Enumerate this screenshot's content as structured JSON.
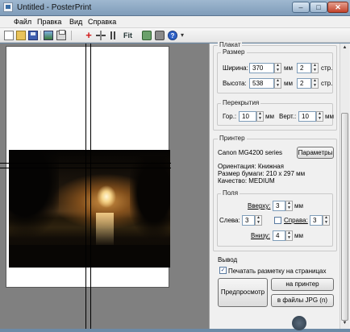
{
  "window": {
    "title": "Untitled - PosterPrint",
    "min": "–",
    "max": "□",
    "close": "✕"
  },
  "menu": [
    {
      "label": "Файл"
    },
    {
      "label": "Правка"
    },
    {
      "label": "Вид"
    },
    {
      "label": "Справка"
    }
  ],
  "toolbar": {
    "fit_label": "Fit",
    "help": "?",
    "more": "▾"
  },
  "panel": {
    "poster_title": "Плакат",
    "size_title": "Размер",
    "width_label": "Ширина:",
    "width_value": "370",
    "height_label": "Высота:",
    "height_value": "538",
    "width_pages": "2",
    "height_pages": "2",
    "unit": "мм",
    "pages_unit": "стр.",
    "overlap_title": "Перекрытия",
    "overlap_h_label": "Гор.:",
    "overlap_h_value": "10",
    "overlap_v_label": "Верт.:",
    "overlap_v_value": "10",
    "printer_title": "Принтер",
    "printer_name": "Canon MG4200 series",
    "params_button": "Параметры",
    "orientation": "Ориентация:  Книжная",
    "paper_size": "Размер бумаги: 210 x 297 мм",
    "quality": "Качество:       MEDIUM",
    "margins_title": "Поля",
    "top_label": "Вверху:",
    "top_value": "3",
    "left_label": "Слева:",
    "left_value": "3",
    "right_label": "Справа:",
    "right_value": "3",
    "bottom_label": "Внизу:",
    "bottom_value": "4",
    "output_title": "Вывод",
    "print_marks_label": "Печатать разметку на страницах",
    "print_marks_checked": "✓",
    "preview_button": "Предпросмотр",
    "to_printer_button": "на принтер",
    "to_jpg_button": "в файлы JPG (n)"
  }
}
